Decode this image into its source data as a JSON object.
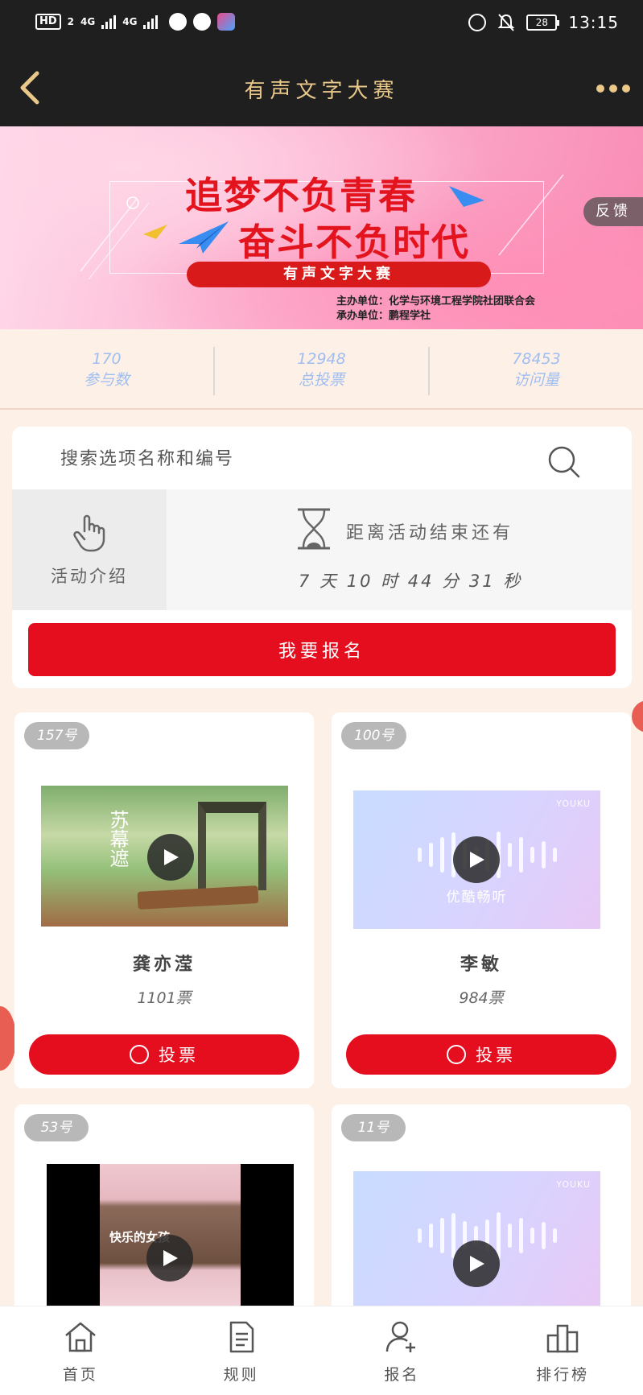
{
  "status_bar": {
    "network_hd": "HD",
    "network_sub": "2",
    "sig1": "4G",
    "sig2": "4G",
    "battery": "28",
    "time": "13:15"
  },
  "nav": {
    "title": "有声文字大赛"
  },
  "banner": {
    "line1": "追梦不负青春",
    "line2": "奋斗不负时代",
    "pill": "有声文字大赛",
    "host_line1": "主办单位：化学与环境工程学院社团联合会",
    "host_line2": "承办单位：鹏程学社",
    "feedback": "反馈"
  },
  "stats": [
    {
      "value": "170",
      "label": "参与数"
    },
    {
      "value": "12948",
      "label": "总投票"
    },
    {
      "value": "78453",
      "label": "访问量"
    }
  ],
  "search": {
    "placeholder": "搜索选项名称和编号"
  },
  "intro": {
    "label": "活动介绍"
  },
  "countdown": {
    "title": "距离活动结束还有",
    "time": "7 天 10 时 44 分 31 秒"
  },
  "signup_button": "我要报名",
  "entries": [
    {
      "number": "157号",
      "name": "龚亦滢",
      "votes": "1101票",
      "vote_label": "投票",
      "thumb_text": "苏幕遮"
    },
    {
      "number": "100号",
      "name": "李敏",
      "votes": "984票",
      "vote_label": "投票",
      "thumb_brand": "YOUKU",
      "thumb_text": "优酷畅听"
    },
    {
      "number": "53号",
      "thumb_text": "快乐的女孩"
    },
    {
      "number": "11号",
      "thumb_brand": "YOUKU"
    }
  ],
  "tabs": [
    {
      "label": "首页",
      "icon": "home-icon"
    },
    {
      "label": "规则",
      "icon": "document-icon"
    },
    {
      "label": "报名",
      "icon": "add-user-icon"
    },
    {
      "label": "排行榜",
      "icon": "ranking-icon"
    }
  ],
  "colors": {
    "primary_red": "#e50e1f",
    "nav_bg": "#1f1f1f",
    "nav_gold": "#e9c88a",
    "stat_blue": "#9fbdf0",
    "page_bg": "#fdf1e7"
  }
}
